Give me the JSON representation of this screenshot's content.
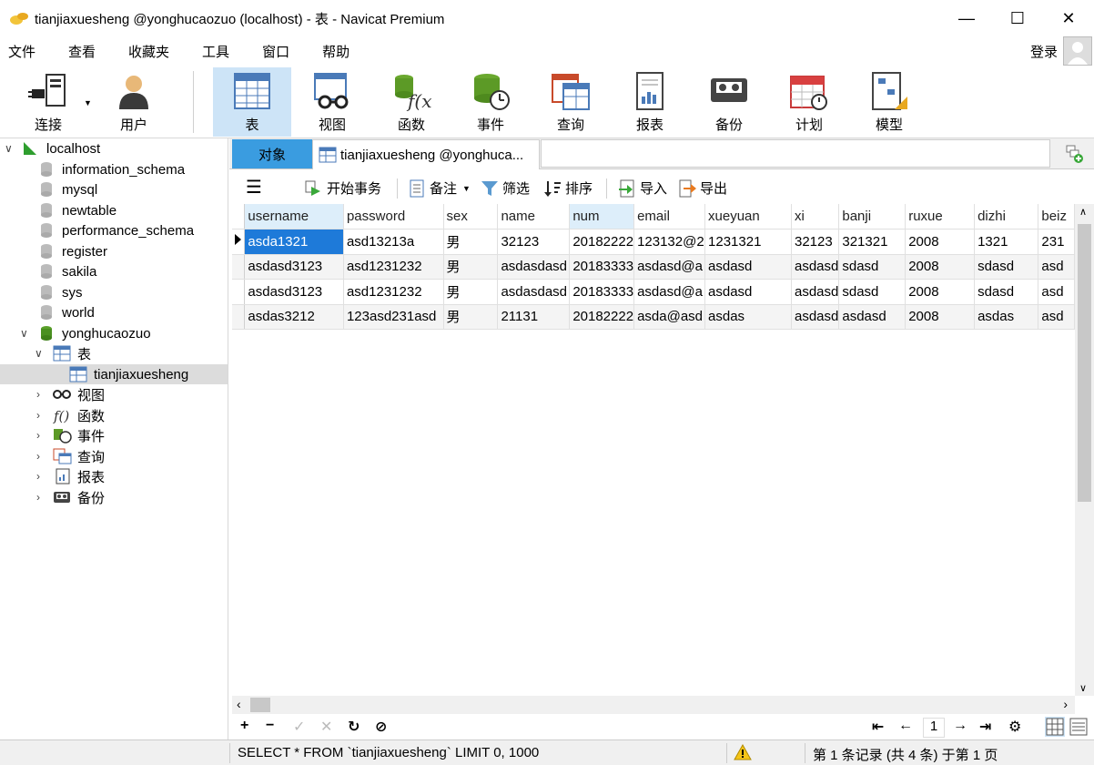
{
  "window": {
    "title": "tianjiaxuesheng @yonghucaozuo (localhost) - 表 - Navicat Premium",
    "minimize": "—",
    "maximize": "☐",
    "close": "✕"
  },
  "menu": [
    "文件",
    "查看",
    "收藏夹",
    "工具",
    "窗口",
    "帮助"
  ],
  "login_label": "登录",
  "toolbar": {
    "connect": "连接",
    "user": "用户",
    "table": "表",
    "view": "视图",
    "function": "函数",
    "event": "事件",
    "query": "查询",
    "report": "报表",
    "backup": "备份",
    "schedule": "计划",
    "model": "模型"
  },
  "tree": {
    "connection": "localhost",
    "databases": [
      "information_schema",
      "mysql",
      "newtable",
      "performance_schema",
      "register",
      "sakila",
      "sys",
      "world"
    ],
    "open_db": "yonghucaozuo",
    "tables_folder": "表",
    "selected_table": "tianjiaxuesheng",
    "folders": [
      "视图",
      "函数",
      "事件",
      "查询",
      "报表",
      "备份"
    ]
  },
  "tabs": {
    "objects": "对象",
    "table_tab": "tianjiaxuesheng @yonghuca..."
  },
  "grid_toolbar": {
    "begin_transaction": "开始事务",
    "memo": "备注",
    "filter": "筛选",
    "sort": "排序",
    "import": "导入",
    "export": "导出"
  },
  "grid": {
    "columns": [
      "username",
      "password",
      "sex",
      "name",
      "num",
      "email",
      "xueyuan",
      "xi",
      "banji",
      "ruxue",
      "dizhi",
      "beiz"
    ],
    "rows": [
      [
        "asda1321",
        "asd13213a",
        "男",
        "32123",
        "20182222",
        "123132@2",
        "1231321",
        "32123",
        "321321",
        "2008",
        "1321",
        "231"
      ],
      [
        "asdasd3123",
        "asd1231232",
        "男",
        "asdasdasd",
        "20183333",
        "asdasd@a",
        "asdasd",
        "asdasd",
        "sdasd",
        "2008",
        "sdasd",
        "asd"
      ],
      [
        "asdasd3123",
        "asd1231232",
        "男",
        "asdasdasd",
        "20183333",
        "asdasd@a",
        "asdasd",
        "asdasd",
        "sdasd",
        "2008",
        "sdasd",
        "asd"
      ],
      [
        "asdas3212",
        "123asd231asd",
        "男",
        "21131",
        "20182222",
        "asda@asd",
        "asdas",
        "asdasd",
        "asdasd",
        "2008",
        "asdas",
        "asd"
      ]
    ]
  },
  "pager": {
    "page": "1"
  },
  "status": {
    "sql": "SELECT * FROM `tianjiaxuesheng` LIMIT 0, 1000",
    "records": "第 1 条记录 (共 4 条) 于第 1 页"
  }
}
